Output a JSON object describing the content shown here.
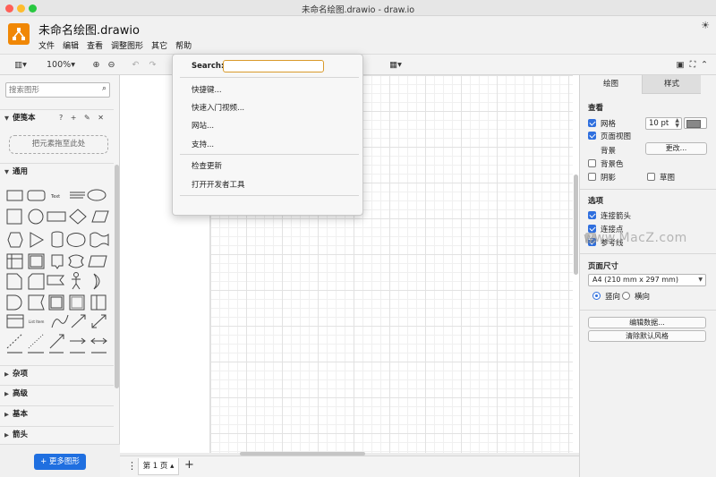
{
  "window": {
    "title": "未命名绘图.drawio - draw.io"
  },
  "header": {
    "doc_title": "未命名绘图.drawio",
    "menus": [
      "文件",
      "编辑",
      "查看",
      "调整图形",
      "其它",
      "帮助"
    ]
  },
  "toolbar": {
    "zoom": "100%"
  },
  "sidebar": {
    "search_placeholder": "搜索图形",
    "scratchpad": {
      "title": "便笺本",
      "tools": "? + ✎ ✕",
      "dropzone": "把元素拖至此处"
    },
    "general": {
      "title": "通用"
    },
    "sections": [
      "杂项",
      "高级",
      "基本",
      "箭头"
    ],
    "more_shapes": "+ 更多图形"
  },
  "pagebar": {
    "page_tab": "第 1 页"
  },
  "help_menu": {
    "search_label": "Search:",
    "search_value": "",
    "items_group1": [
      "快捷键...",
      "快速入门视频...",
      "网站...",
      "支持..."
    ],
    "items_group2": [
      "检查更新",
      "打开开发者工具"
    ]
  },
  "format_panel": {
    "tabs": [
      "绘图",
      "样式"
    ],
    "view_title": "查看",
    "grid_label": "网格",
    "grid_checked": true,
    "grid_size": "10 pt",
    "page_view_label": "页面视图",
    "page_view_checked": true,
    "background_label": "背景",
    "change_btn": "更改...",
    "bg_color_label": "背景色",
    "shadow_label": "阴影",
    "sketch_label": "草图",
    "options_title": "选项",
    "connection_arrows": "连接箭头",
    "connection_points": "连接点",
    "guides": "参考线",
    "page_size_title": "页面尺寸",
    "page_size_value": "A4 (210 mm x 297 mm)",
    "portrait": "竖向",
    "landscape": "横向",
    "edit_data_btn": "编辑数据...",
    "clear_style_btn": "清除默认风格"
  },
  "watermark": {
    "text": "www.MacZ.com",
    "logo_letter": "Z"
  }
}
